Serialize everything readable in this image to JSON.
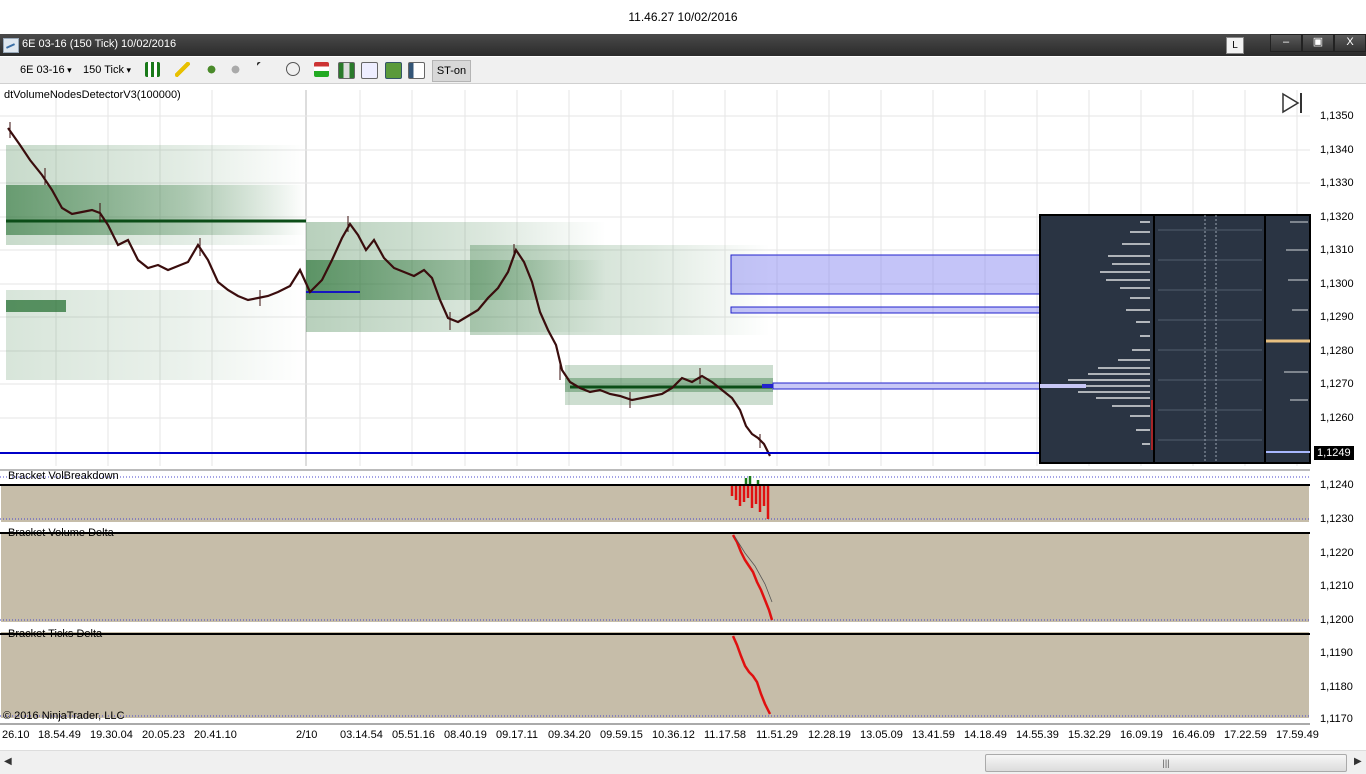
{
  "top_timestamp": "11.46.27 10/02/2016",
  "window": {
    "title": "6E 03-16 (150 Tick)  10/02/2016",
    "link_button": "L",
    "minimize": "–",
    "maximize": "▣",
    "close": "X"
  },
  "toolbar": {
    "instrument": "6E 03-16",
    "interval": "150 Tick",
    "st_on": "ST-on"
  },
  "panels": {
    "indicator_label": "dtVolumeNodesDetectorV3(100000)",
    "vol_breakdown": "Bracket VolBreakdown",
    "volume_delta": "Bracket Volume Delta",
    "ticks_delta": "Bracket Ticks Delta",
    "copyright": "© 2016 NinjaTrader, LLC"
  },
  "price_axis": {
    "main_ticks": [
      "1,1350",
      "1,1340",
      "1,1330",
      "1,1320",
      "1,1310",
      "1,1300",
      "1,1290",
      "1,1280",
      "1,1270",
      "1,1260"
    ],
    "current_price": "1,1249",
    "panel1_ticks": [
      "1,1240",
      "1,1230"
    ],
    "panel2_ticks": [
      "1,1220",
      "1,1210",
      "1,1200"
    ],
    "panel3_ticks": [
      "1,1190",
      "1,1180",
      "1,1170"
    ]
  },
  "time_axis": [
    "26.10",
    "18.54.49",
    "19.30.04",
    "20.05.23",
    "20.41.10",
    "2/10",
    "03.14.54",
    "05.51.16",
    "08.40.19",
    "09.17.11",
    "09.34.20",
    "09.59.15",
    "10.36.12",
    "11.17.58",
    "11.51.29",
    "12.28.19",
    "13.05.09",
    "13.41.59",
    "14.18.49",
    "14.55.39",
    "15.32.29",
    "16.09.19",
    "16.46.09",
    "17.22.59",
    "17.59.49"
  ],
  "colors": {
    "panel_bg": "#c6bda9",
    "node_green": "#1d6a2a",
    "zone_blue": "#7d7df0",
    "price_line": "#0000c8",
    "profile_bg": "#2a3443"
  }
}
